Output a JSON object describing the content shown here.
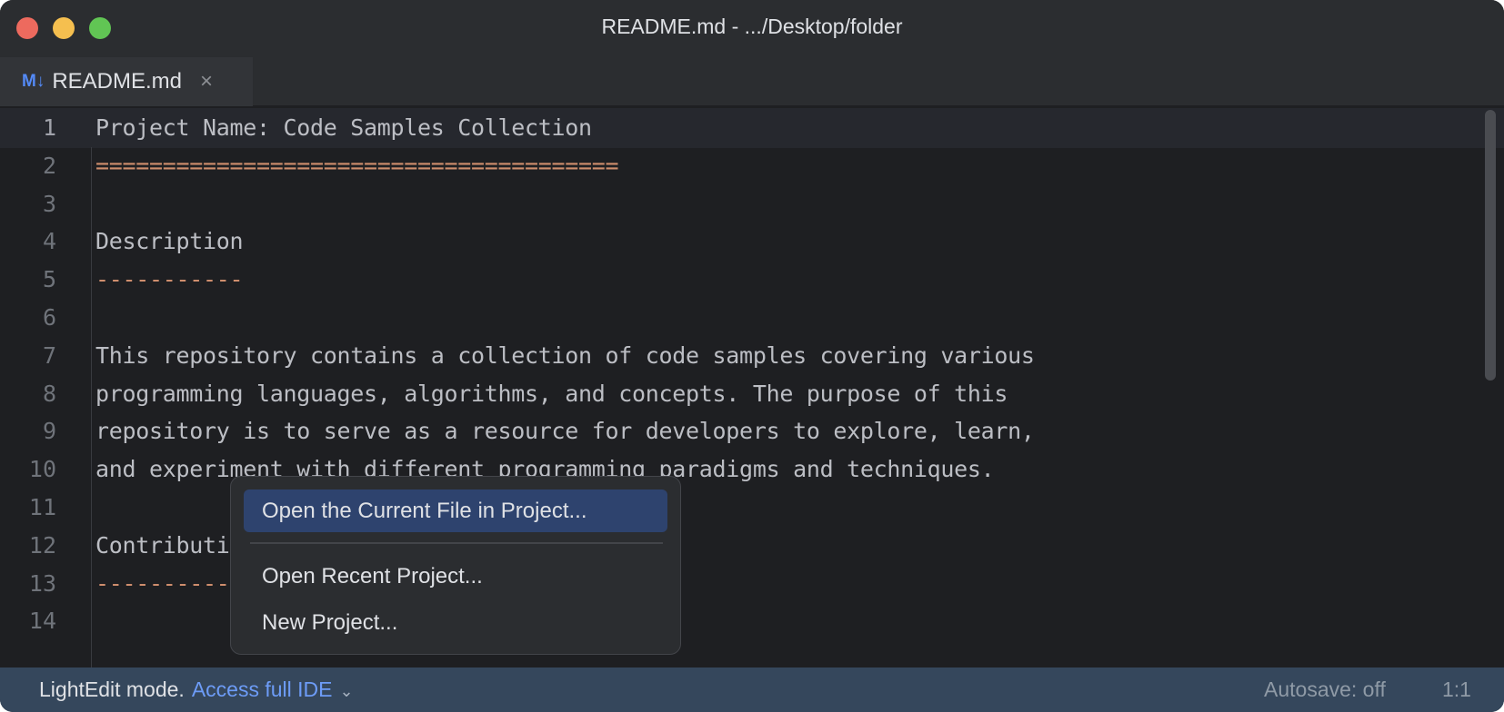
{
  "window": {
    "title": "README.md - .../Desktop/folder"
  },
  "tab": {
    "icon": "M↓",
    "label": "README.md",
    "close": "×"
  },
  "editor": {
    "lines": [
      {
        "n": "1",
        "text": "Project Name: Code Samples Collection",
        "hl": false
      },
      {
        "n": "2",
        "text": "=======================================",
        "hl": true
      },
      {
        "n": "3",
        "text": "",
        "hl": false
      },
      {
        "n": "4",
        "text": "Description",
        "hl": false
      },
      {
        "n": "5",
        "text": "-----------",
        "hl": true
      },
      {
        "n": "6",
        "text": "",
        "hl": false
      },
      {
        "n": "7",
        "text": "This repository contains a collection of code samples covering various",
        "hl": false
      },
      {
        "n": "8",
        "text": "programming languages, algorithms, and concepts. The purpose of this",
        "hl": false
      },
      {
        "n": "9",
        "text": "repository is to serve as a resource for developers to explore, learn,",
        "hl": false
      },
      {
        "n": "10",
        "text": "and experiment with different programming paradigms and techniques.",
        "hl": false
      },
      {
        "n": "11",
        "text": "",
        "hl": false
      },
      {
        "n": "12",
        "text": "Contributing",
        "hl": false
      },
      {
        "n": "13",
        "text": "------------",
        "hl": true
      },
      {
        "n": "14",
        "text": "",
        "hl": false
      }
    ]
  },
  "menu": {
    "items": [
      "Open the Current File in Project...",
      "Open Recent Project...",
      "New Project..."
    ]
  },
  "status": {
    "mode": "LightEdit mode.",
    "link": "Access full IDE",
    "chevron": "⌄",
    "autosave": "Autosave: off",
    "position": "1:1"
  },
  "colors": {
    "accent": "#548af7",
    "status_bg": "#35475c",
    "heading_marker": "#cf8e6d"
  }
}
